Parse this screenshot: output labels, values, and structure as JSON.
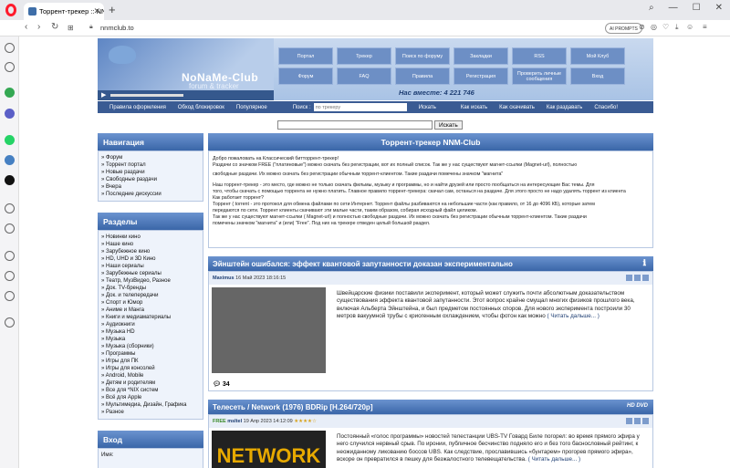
{
  "browser": {
    "tab_title": "Торрент-трекер :: NNM-Cl",
    "url": "nnmclub.to",
    "ai_prompts": "AI PROMPTS"
  },
  "header": {
    "logo_title": "NoNaMe-Club",
    "logo_sub": "forum & tracker",
    "together": "Нас вместе: 4 221 746",
    "menu": [
      "Портал",
      "Трекер",
      "Поиск по форуму",
      "Закладки",
      "RSS",
      "Мой Клуб",
      "Форум",
      "FAQ",
      "Правила",
      "Регистрация",
      "Проверить личные сообщения",
      "Вход"
    ]
  },
  "subnav": {
    "links_left": [
      "Правила оформления",
      "Обход блокировок",
      "Популярное"
    ],
    "search_label": "Поиск :",
    "search_placeholder": "по трекеру",
    "search_button": "Искать",
    "links_right": [
      "Как искать",
      "Как скачивать",
      "Как раздавать",
      "Спасибо!"
    ]
  },
  "search": {
    "button": "Искать"
  },
  "left": {
    "nav_title": "Навигация",
    "nav_items": [
      "» Форум",
      "» Торрент портал",
      "» Новые раздачи",
      "» Свободные раздачи",
      "» Вчера",
      "» Последние дискуссии"
    ],
    "sections_title": "Разделы",
    "sections_items": [
      "» Новинки кино",
      "» Наше кино",
      "» Зарубежное кино",
      "» HD, UHD и 3D Кино",
      "» Наши сериалы",
      "» Зарубежные сериалы",
      "» Театр, МузВидео, Разное",
      "» Док. TV-бренды",
      "» Док. и телепередачи",
      "» Спорт и Юмор",
      "» Аниме и Манга",
      "» Книги и медиаматериалы",
      "» Аудиокниги",
      "» Музыка HD",
      "» Музыка",
      "» Музыка (сборники)",
      "» Программы",
      "» Игры для ПК",
      "» Игры для консолей",
      "» Android, Mobile",
      "» Детям и родителям",
      "» Все для *NIX систем",
      "» Всё для Apple",
      "» Мультимедиа, Дизайн, Графика",
      "» Разное"
    ],
    "login_title": "Вход",
    "login_label": "Имя:"
  },
  "main": {
    "title": "Торрент-трекер NNM-Club",
    "intro": [
      "Добро пожаловать на Классический битторрент-трекер!",
      "Раздачи со значком FREE (\"платиновые\") можно скачать без регистрации, вот их полный список. Так же у нас существуют магнет-ссылки (Magnet-url), полностью",
      "свободные раздачи. Их можно скачать без регистрации обычным торрент-клиентом. Такие раздачи помечены значком \"магнита\"",
      "Наш торрент-трекер - это место, где можно не только скачать фильмы, музыку и программы, но и найти друзей или просто пообщаться на интересующие Вас темы. Для",
      "того, чтобы скачать с помощью торрента не нужно платить. Главное правило торрент-трекера: скачал сам, останься на раздаче. Для этого просто не надо удалять торрент из клиента",
      "Как работает торрент?",
      "Торрент ( torrent - это протокол для обмена файлами по сети Интернет. Торрент файлы разбиваются на небольшие части (как правило, от 16 до 4096 КБ), которые затем",
      "передаются по сети. Торрент клиенты скачивают эти малые части, таким образом, собирая исходный файл целиком.",
      "Так же у нас существуют магнет-ссылки ( Magnet-url) и полностью свободные раздачи. Их можно скачать без регистрации обычным торрент-клиентом. Такие раздачи",
      "помечены значком \"магнита\" и (или) \"Free\". Под них на трекере отведен целый большой раздел."
    ],
    "news1": {
      "title": "Эйнштейн ошибался: эффект квантовой запутанности доказан экспериментально",
      "author": "Maximus",
      "date": "16 Май 2023 18:16:15",
      "text": "Швейцарские физики поставили эксперимент, который может служить почти абсолютным доказательством существования эффекта квантовой запутанности. Этот вопрос крайне смущал многих физиков прошлого века, включая Альберта Эйнштейна, и был предметом постоянных споров. Для нового эксперимента построили 30 метров вакуумной трубы с криогенным охлаждением, чтобы фотон как можно",
      "more": "( Читать дальше... )",
      "comments": "34"
    },
    "news2": {
      "title": "Телесеть / Network (1976) BDRip [H.264/720p]",
      "free": "FREE",
      "author": "msltel",
      "date": "19 Апр 2023 14:12:09",
      "stars": "★★★★☆",
      "text": "Постоянный «голос программы» новостей телестанции UBS-TV Говард Биле погорел: во время прямого эфира у него случился нервный срыв. По иронии, публичное бесчинство подняло его и без того баснословный рейтинг, к неожиданному ликованию боссов UBS. Как следствие, прославившись «бунтарем» прогорев прямого эфира», вскоре он превратился в пешку для безжалостного телевещательства.",
      "more": "( Читать дальше... )",
      "image_text": "NETWORK"
    }
  },
  "colors": {
    "accent": "#3a66a8",
    "header": "#a9c3e5"
  }
}
